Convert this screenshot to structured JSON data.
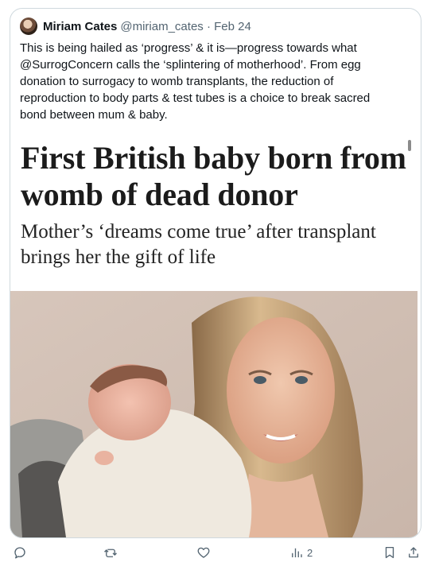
{
  "tweet": {
    "author_name": "Miriam Cates",
    "handle_date": "@miriam_cates · Feb 24",
    "text": "This is being hailed as ‘progress’ & it is—progress towards what\n@SurrogConcern calls the ‘splintering of motherhood’. From egg\ndonation to surrogacy to womb transplants, the reduction of\nreproduction to body parts & test tubes is a choice to break sacred\nbond between mum & baby."
  },
  "media": {
    "headline": "First British baby born from womb of dead donor",
    "subheadline": "Mother’s ‘dreams come true’ after transplant brings her the gift of life"
  },
  "actions": {
    "reply_icon": "reply-icon",
    "retweet_icon": "retweet-icon",
    "like_icon": "heart-icon",
    "views_icon": "views-icon",
    "views_count": "2",
    "bookmark_icon": "bookmark-icon",
    "share_icon": "share-icon"
  }
}
